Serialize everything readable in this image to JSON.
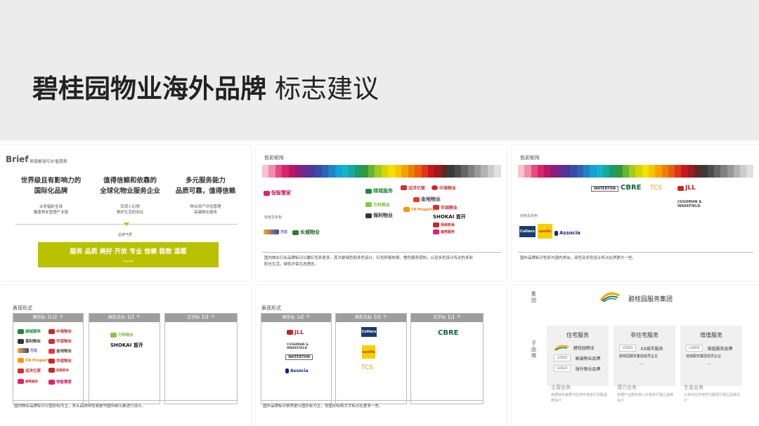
{
  "header": {
    "title_bold": "碧桂园物业海外品牌",
    "title_light": "标志建议"
  },
  "colors": {
    "banner_bg": "#ececec",
    "accent_green": "#b9c100",
    "gray_head": "#9e9e9e",
    "palette": [
      "#f7c3cf",
      "#f28cad",
      "#e94a7d",
      "#d8246c",
      "#b8185e",
      "#8e1f7a",
      "#6a2c8e",
      "#4e3896",
      "#3b4aa6",
      "#2a63b8",
      "#1e84c7",
      "#15a2d4",
      "#13b4c8",
      "#18a99a",
      "#1c9c6b",
      "#2e9a3c",
      "#6bb52e",
      "#a6c921",
      "#d5d600",
      "#f2e200",
      "#f8c500",
      "#f5a100",
      "#ee7f00",
      "#e85d0c",
      "#e0351b",
      "#c9161d",
      "#9b1b1e",
      "#5c2a22",
      "#3a3a3a",
      "#4d4d4d",
      "#666666",
      "#808080",
      "#999999",
      "#b3b3b3",
      "#cccccc",
      "#e0e0e0"
    ]
  },
  "brief": {
    "label": "Brief",
    "sublabel": "项目解读与价值提炼",
    "cols": [
      {
        "h1": "世界级且有影响力的",
        "h2": "国际化品牌",
        "s1": "业务辐射全球",
        "s2": "覆盖物业管理产业链"
      },
      {
        "h1": "值得信赖和依靠的",
        "h2": "全球化物业服务企业",
        "s1": "实现人幻想",
        "s2": "美好生活的向往"
      },
      {
        "h1": "多元服务能力",
        "h2": "品质可靠，值得信赖",
        "s1": "物业资产评估管理",
        "s2": "高端物业服务"
      }
    ],
    "mood_label": "品牌气质",
    "mood_words": "服务 品质 美好 开放 专业 信赖 极致 温暖",
    "mood_ellipsis": "……"
  },
  "domestic_color": {
    "label": "色彩矩阵",
    "dual_label": "双色及多色",
    "note_line1": "国内物业行业品牌标识以暖红色系居多，其次是绿色和多色设计，红色积极热情，橙色服务感知，以及多色设计传达的多彩",
    "note_line2": "阳光生活，绿色环保生态理念。",
    "logos": {
      "hmj": "恒智慧家",
      "lcfw": "绿城服务",
      "yj": "远洋亿家",
      "zhwy": "中海物业",
      "jdwy": "金地物业",
      "wkwy": "万科物业",
      "hrwy": "华润物业",
      "crp": "CR Property",
      "blwy": "保利物业",
      "shokai": "SHOKAI 首开",
      "zsjy": "招商积余",
      "ycbs": "越秀服务",
      "cc": "长城物业",
      "ws": "万达"
    }
  },
  "overseas_color": {
    "label": "色彩矩阵",
    "dual_label": "双色及多色",
    "note": "国外品牌标识色彩与国内类似，双色及多色设计所占比例更大一些。",
    "logos": {
      "waterton": "WATERTON",
      "cbre": "CBRE",
      "tcs": "TCS",
      "jll": "JLL",
      "cw1": "CUSHMAN &",
      "cw2": "WAKEFIELD",
      "colliers": "Colliers",
      "savills": "savills",
      "associa": "Associa"
    }
  },
  "domestic_form": {
    "label": "表现形式",
    "cols": [
      "图形标【12】个",
      "图形文标【2】个",
      "文字标【0】个"
    ],
    "note": "国内物业品牌标识以图形标为主，多从品牌特性或是中国传统元素进行设计。"
  },
  "overseas_form": {
    "label": "表现形式",
    "cols": [
      "图形标【4】个",
      "图形文标【3】个",
      "文字标【1】个"
    ],
    "note": "国外品牌标识依然是以图形标为主，但图形标和文字标占比更多一些。"
  },
  "structure": {
    "group_label": "集团",
    "sub_label": "子品牌",
    "group_name": "碧桂园服务集团",
    "boxes": [
      {
        "title": "住宅服务",
        "items": [
          "碧桂园物业",
          "高端物业品牌",
          "海外物业品牌"
        ],
        "foot_title": "主营业务",
        "foot_desc": "依据目标客群与应用环境进行关联品牌设计"
      },
      {
        "title": "非住宅服务",
        "items": [
          "XX城市服务",
          "碧桂园服务集团成员企业",
          "..."
        ],
        "foot_title": "潜力业务",
        "foot_desc": "依据产业服务核心价值进行独立品牌设计"
      },
      {
        "title": "增值服务",
        "items": [
          "增值服务品牌",
          "增值服务集团成员企业",
          "..."
        ],
        "foot_title": "生态业务",
        "foot_desc": "以突出业务特性为集团行独立品牌设计"
      }
    ],
    "logo_tag": "LOGO"
  }
}
